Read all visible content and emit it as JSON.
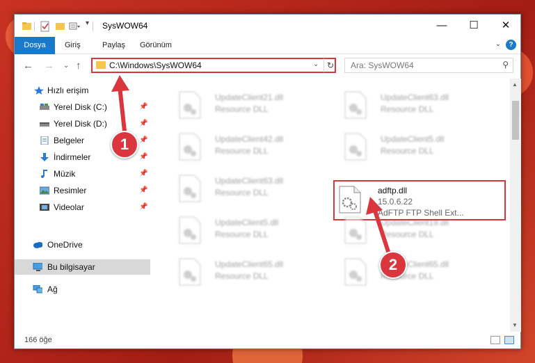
{
  "window": {
    "title": "SysWOW64",
    "controls": {
      "minimize": "—",
      "maximize": "☐",
      "close": "✕"
    }
  },
  "ribbon": {
    "tabs": [
      "Dosya",
      "Giriş",
      "Paylaş",
      "Görünüm"
    ],
    "help": "?"
  },
  "address": {
    "path": "C:\\Windows\\SysWOW64",
    "search_placeholder": "Ara: SysWOW64"
  },
  "nav_pane": {
    "items": [
      {
        "label": "Hızlı erişim",
        "icon": "star-icon",
        "pinned": false
      },
      {
        "label": "Yerel Disk (C:)",
        "icon": "drive-icon",
        "pinned": true
      },
      {
        "label": "Yerel Disk (D:)",
        "icon": "drive-icon",
        "pinned": true
      },
      {
        "label": "Belgeler",
        "icon": "documents-icon",
        "pinned": true
      },
      {
        "label": "İndirmeler",
        "icon": "download-icon",
        "pinned": true
      },
      {
        "label": "Müzik",
        "icon": "music-icon",
        "pinned": true
      },
      {
        "label": "Resimler",
        "icon": "pictures-icon",
        "pinned": true
      },
      {
        "label": "Videolar",
        "icon": "video-icon",
        "pinned": true
      },
      {
        "label": "OneDrive",
        "icon": "cloud-icon",
        "pinned": false
      },
      {
        "label": "Bu bilgisayar",
        "icon": "computer-icon",
        "pinned": false,
        "selected": true
      },
      {
        "label": "Ağ",
        "icon": "network-icon",
        "pinned": false
      }
    ]
  },
  "files": [
    {
      "name": "UpdateClient21.dll",
      "desc": "Resource DLL"
    },
    {
      "name": "UpdateClient63.dll",
      "desc": "Resource DLL"
    },
    {
      "name": "UpdateClient42.dll",
      "desc": "Resource DLL"
    },
    {
      "name": "UpdateClient5.dll",
      "desc": "Resource DLL"
    },
    {
      "name": "UpdateClient63.dll",
      "desc": "Resource DLL"
    },
    {
      "name": "adftp.dll",
      "version": "15.0.6.22",
      "desc": "AdFTP FTP Shell Ext..."
    },
    {
      "name": "UpdateClient5.dll",
      "desc": "Resource DLL"
    },
    {
      "name": "UpdateClient19.dll",
      "desc": "Resource DLL"
    },
    {
      "name": "UpdateClient65.dll",
      "desc": "Resource DLL"
    },
    {
      "name": "UpdateClient65.dll",
      "desc": "Resource DLL"
    }
  ],
  "status": {
    "count": "166 öğe"
  },
  "annotations": {
    "step1": "1",
    "step2": "2"
  },
  "colors": {
    "accent": "#1979ca",
    "highlight": "#d9363e",
    "folder": "#f3c74d"
  }
}
